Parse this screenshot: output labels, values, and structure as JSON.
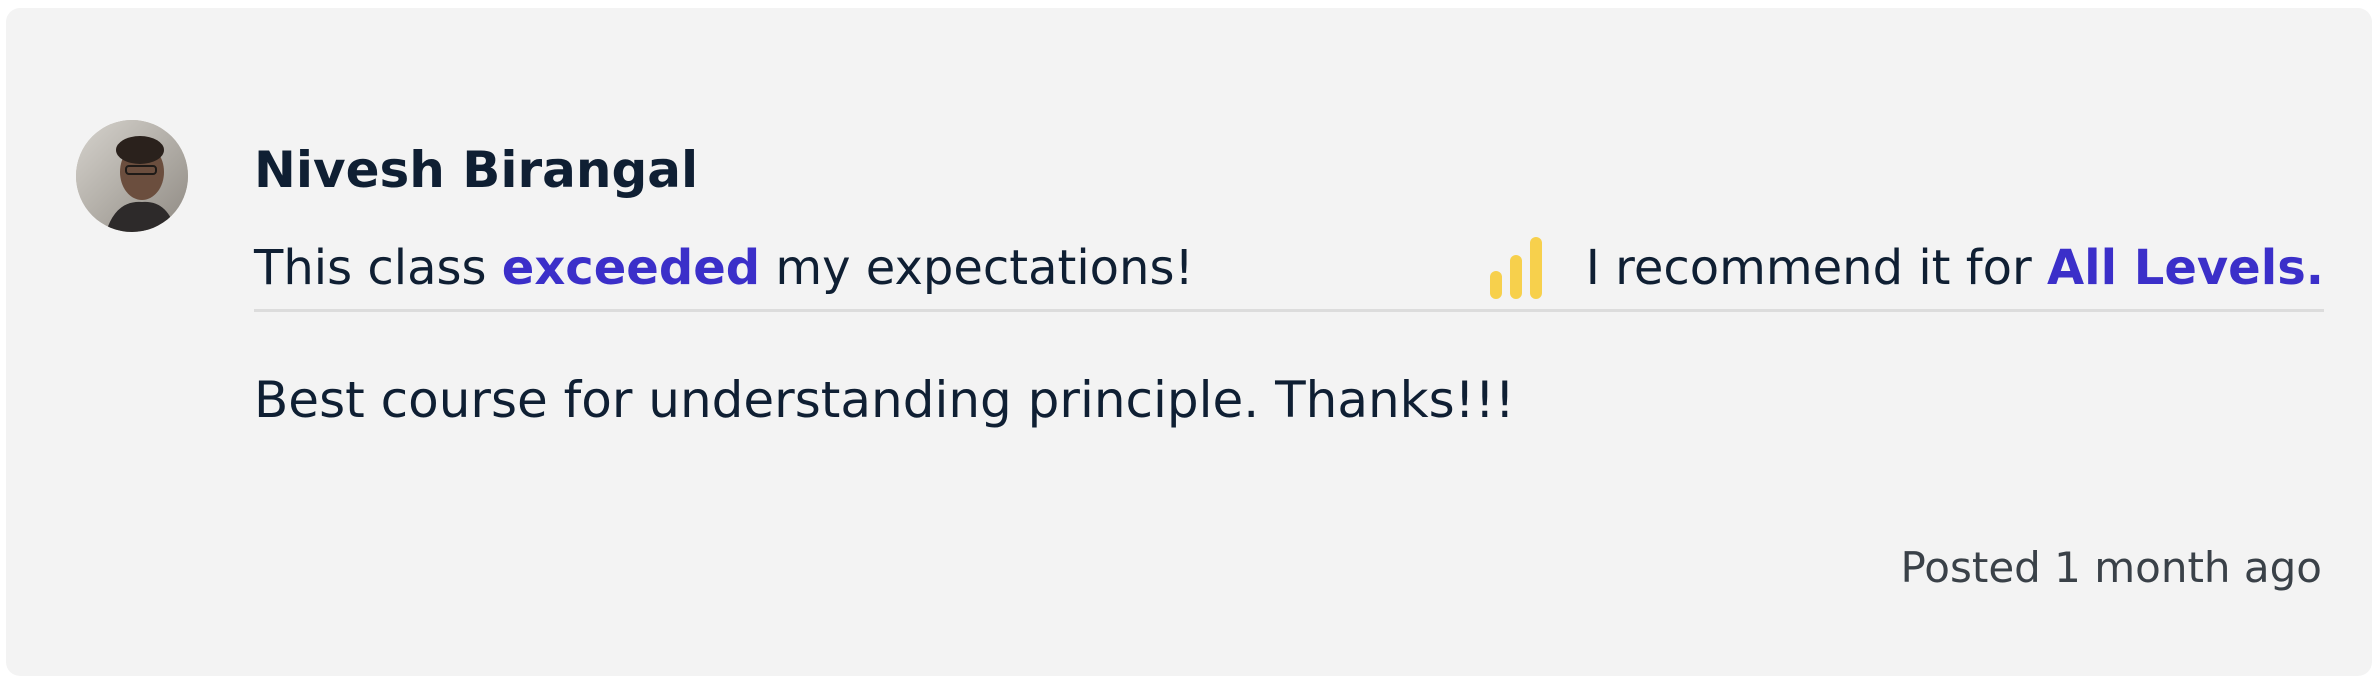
{
  "review": {
    "author_name": "Nivesh Birangal",
    "expectation": {
      "prefix": "This class ",
      "highlight": "exceeded",
      "suffix": " my expectations!"
    },
    "recommendation": {
      "prefix": "I recommend it for ",
      "level": "All Levels.",
      "icon": "level-bars-icon"
    },
    "body": "Best course for understanding principle. Thanks!!!",
    "posted": "Posted 1 month ago"
  },
  "colors": {
    "card_background": "#f3f3f3",
    "text": "#0f1f33",
    "accent": "#3b2fc9",
    "level_icon": "#f7d04c",
    "divider": "#dcdcdc",
    "meta_text": "#3a4148"
  }
}
